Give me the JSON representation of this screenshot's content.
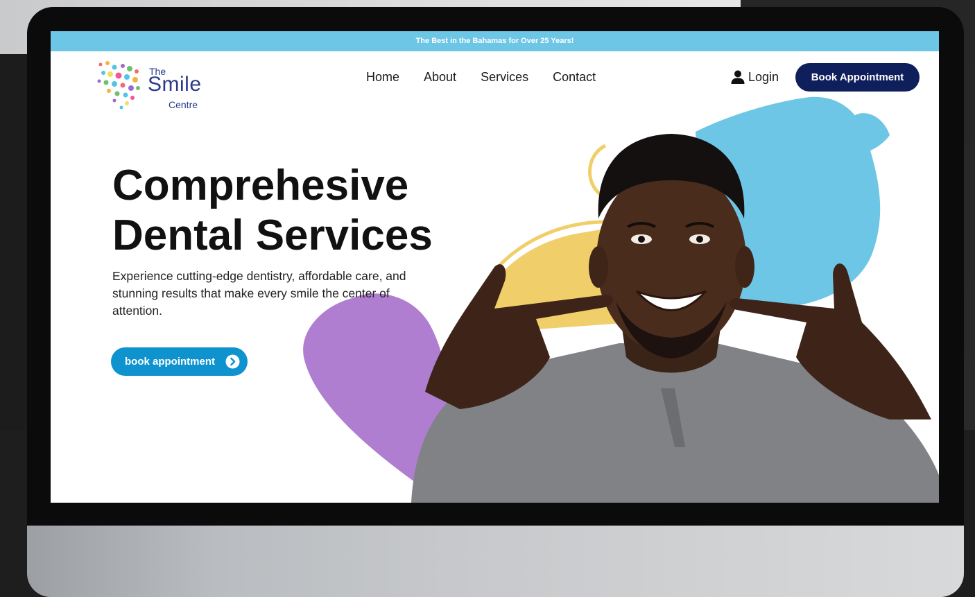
{
  "announcement": "The Best in the Bahamas for Over 25 Years!",
  "brand": {
    "the": "The",
    "smile": "Smile",
    "centre": "Centre"
  },
  "nav": {
    "items": [
      "Home",
      "About",
      "Services",
      "Contact"
    ],
    "login_label": "Login",
    "book_label": "Book Appointment"
  },
  "hero": {
    "title_line1": "Comprehesive",
    "title_line2": "Dental Services",
    "subtitle": "Experience cutting-edge dentistry, affordable care, and stunning results that make every smile the center of attention.",
    "cta_label": "book appointment"
  },
  "icons": {
    "login": "user-icon",
    "cta": "chevron-right-circle-icon"
  },
  "colors": {
    "announce_bg": "#6ec6e6",
    "primary_navy": "#0f1f5c",
    "cta_blue": "#0e93cf",
    "blob_blue": "#6ec6e6",
    "blob_purple": "#b07ed0",
    "blob_yellow": "#f0cf6a"
  }
}
